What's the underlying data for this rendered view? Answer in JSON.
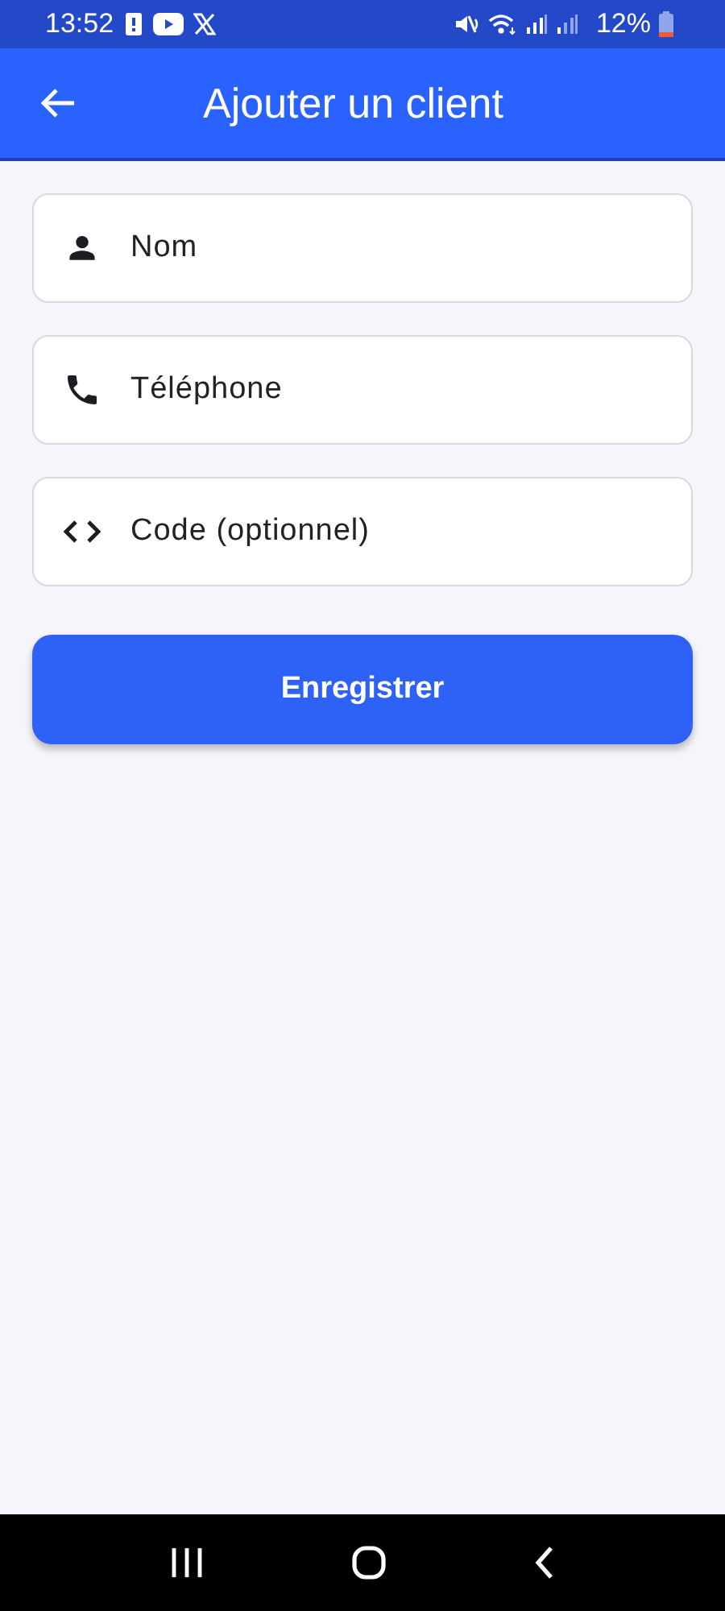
{
  "status_bar": {
    "time": "13:52",
    "battery": "12%"
  },
  "app_bar": {
    "title": "Ajouter un client"
  },
  "fields": [
    {
      "kind": "person",
      "placeholder": "Nom"
    },
    {
      "kind": "phone",
      "placeholder": "Téléphone"
    },
    {
      "kind": "code",
      "placeholder": "Code (optionnel)"
    }
  ],
  "save_button": "Enregistrer"
}
